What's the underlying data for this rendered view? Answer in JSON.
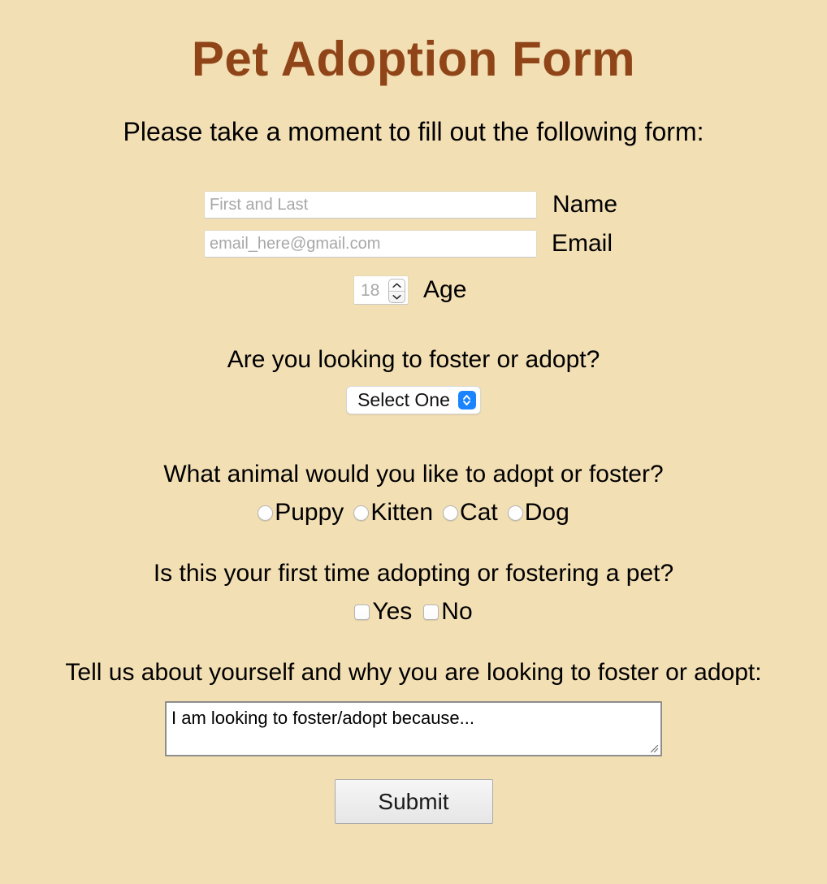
{
  "page": {
    "title": "Pet Adoption Form",
    "subtitle": "Please take a moment to fill out the following form:",
    "background_color": "#f3dfb4",
    "title_color": "#8f4518"
  },
  "fields": {
    "name": {
      "label": "Name",
      "placeholder": "First and Last",
      "value": ""
    },
    "email": {
      "label": "Email",
      "placeholder": "email_here@gmail.com",
      "value": ""
    },
    "age": {
      "label": "Age",
      "placeholder": "18",
      "value": ""
    }
  },
  "foster_or_adopt": {
    "question": "Are you looking to foster or adopt?",
    "selected": "Select One",
    "options": [
      "Select One"
    ]
  },
  "animal_choice": {
    "question": "What animal would you like to adopt or foster?",
    "options": [
      {
        "label": "Puppy",
        "checked": false
      },
      {
        "label": "Kitten",
        "checked": false
      },
      {
        "label": "Cat",
        "checked": false
      },
      {
        "label": "Dog",
        "checked": false
      }
    ]
  },
  "first_time": {
    "question": "Is this your first time adopting or fostering a pet?",
    "options": [
      {
        "label": "Yes",
        "checked": false
      },
      {
        "label": "No",
        "checked": false
      }
    ]
  },
  "about_you": {
    "question": "Tell us about yourself and why you are looking to foster or adopt:",
    "value": "I am looking to foster/adopt because..."
  },
  "submit": {
    "label": "Submit"
  }
}
